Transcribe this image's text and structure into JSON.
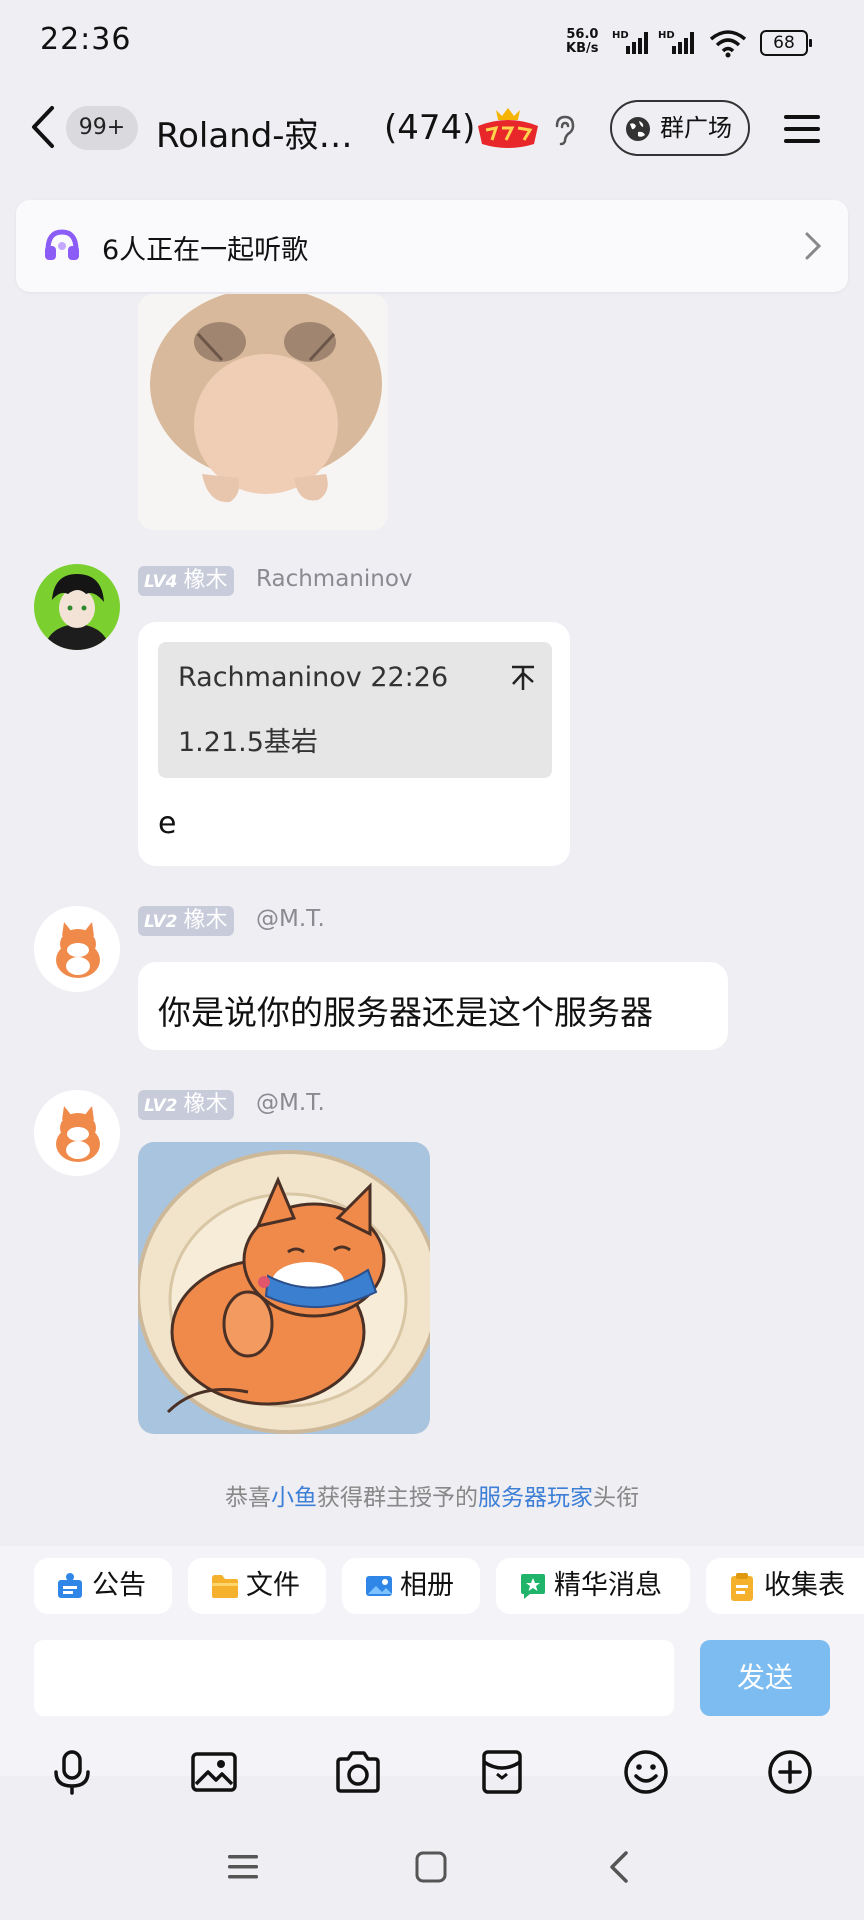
{
  "status_bar": {
    "time": "22:36",
    "net_speed": "56.0",
    "net_unit": "KB/s",
    "signal1": "HD",
    "signal2": "HD",
    "battery": "68"
  },
  "header": {
    "unread_badge": "99+",
    "title": "Roland-寂…",
    "member_count": "(474)",
    "square_button": "群广场",
    "icons": [
      "back-arrow-icon",
      "emblem-icon",
      "ear-icon",
      "globe-icon",
      "menu-icon"
    ]
  },
  "banner": {
    "text": "6人正在一起听歌"
  },
  "messages": [
    {
      "type": "image",
      "image_desc": "cat-sticker"
    },
    {
      "type": "text",
      "level": "LV4",
      "title": "橡木",
      "nickname": "Rachmaninov",
      "quote_author": "Rachmaninov 22:26",
      "quote_text": "1.21.5基岩",
      "text": "e"
    },
    {
      "type": "text",
      "level": "LV2",
      "title": "橡木",
      "nickname": "@M.T.",
      "text": "你是说你的服务器还是这个服务器"
    },
    {
      "type": "image",
      "level": "LV2",
      "title": "橡木",
      "nickname": "@M.T."
    }
  ],
  "system_message": {
    "prefix": "恭喜",
    "user": "小鱼",
    "middle": "获得群主授予的",
    "honor": "服务器玩家",
    "suffix": "头衔"
  },
  "toolbar": {
    "chips": [
      "公告",
      "文件",
      "相册",
      "精华消息",
      "收集表"
    ],
    "send_label": "发送",
    "bottom_icons": [
      "microphone-icon",
      "picture-icon",
      "camera-icon",
      "red-packet-icon",
      "emoji-icon",
      "plus-icon"
    ]
  },
  "colors": {
    "background": "#eeeef3",
    "send_button": "#7cbcf0",
    "link": "#3d7fd6",
    "level_badge": "#c8cbd9"
  }
}
